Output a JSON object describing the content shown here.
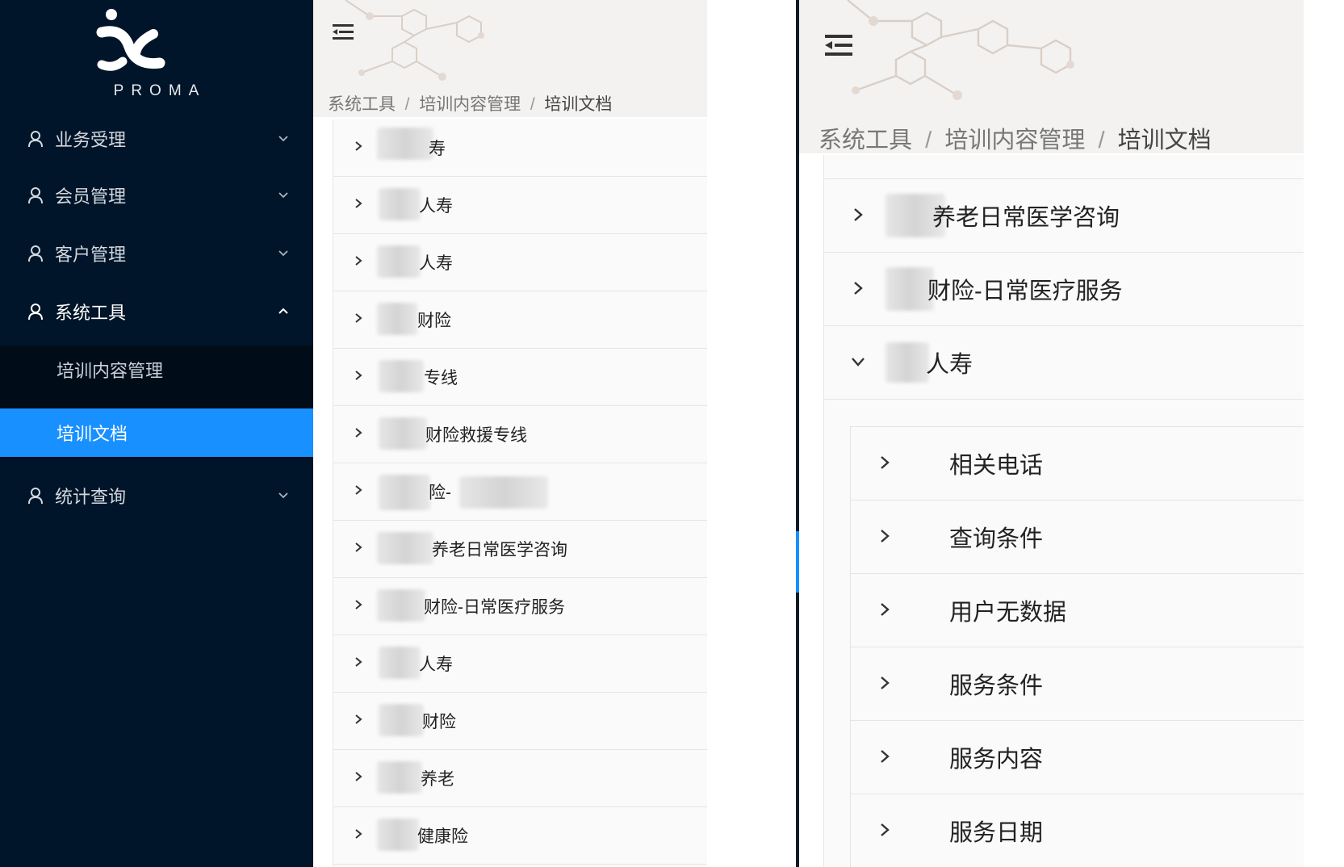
{
  "sidebar": {
    "logo_text": "PROMA",
    "menu": [
      {
        "label": "业务受理",
        "icon": "user-icon",
        "open": false
      },
      {
        "label": "会员管理",
        "icon": "user-icon",
        "open": false
      },
      {
        "label": "客户管理",
        "icon": "user-icon",
        "open": false
      },
      {
        "label": "系统工具",
        "icon": "user-icon",
        "open": true
      },
      {
        "label": "统计查询",
        "icon": "user-icon",
        "open": false
      }
    ],
    "submenu": [
      {
        "label": "培训内容管理",
        "active": false
      },
      {
        "label": "培训文档",
        "active": true
      }
    ],
    "active_color": "#1890ff",
    "bg_color": "#001529"
  },
  "left_panel": {
    "breadcrumb": [
      "系统工具",
      "培训内容管理",
      "培训文档"
    ],
    "items": [
      {
        "label": "寿"
      },
      {
        "label": "人寿"
      },
      {
        "label": "人寿"
      },
      {
        "label": "财险"
      },
      {
        "label": "专线"
      },
      {
        "label": "财险救援专线"
      },
      {
        "label": "险-"
      },
      {
        "label": "养老日常医学咨询"
      },
      {
        "label": "财险-日常医疗服务"
      },
      {
        "label": "人寿"
      },
      {
        "label": "财险"
      },
      {
        "label": "养老"
      },
      {
        "label": "健康险"
      }
    ]
  },
  "right_panel": {
    "breadcrumb": [
      "系统工具",
      "培训内容管理",
      "培训文档"
    ],
    "items": [
      {
        "label": "养老日常医学咨询",
        "expanded": false
      },
      {
        "label": "财险-日常医疗服务",
        "expanded": false
      },
      {
        "label": "人寿",
        "expanded": true
      }
    ],
    "children": [
      {
        "label": "相关电话"
      },
      {
        "label": "查询条件"
      },
      {
        "label": "用户无数据"
      },
      {
        "label": "服务条件"
      },
      {
        "label": "服务内容"
      },
      {
        "label": "服务日期"
      }
    ]
  }
}
